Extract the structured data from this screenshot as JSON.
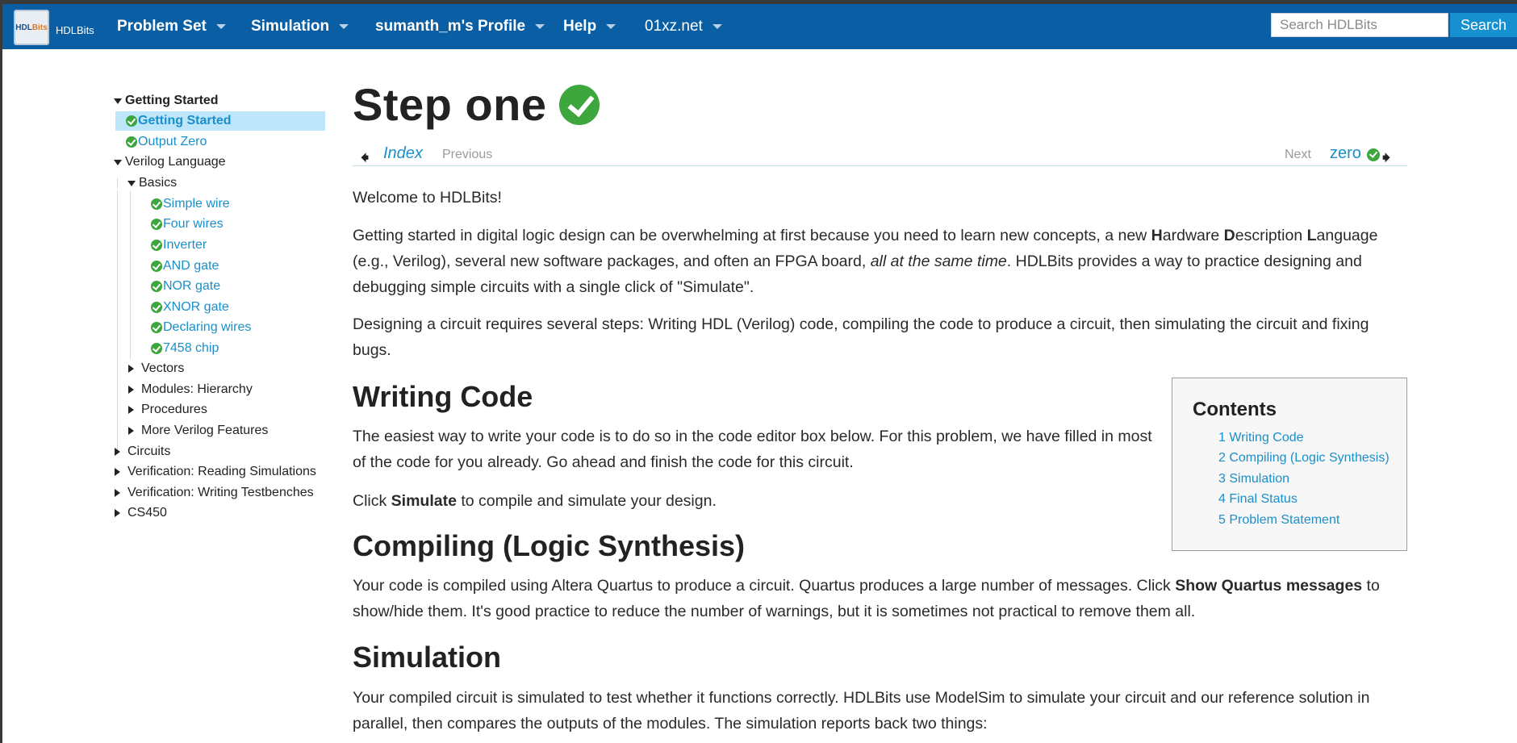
{
  "header": {
    "logo_text_a": "HDL",
    "logo_text_b": "Bits",
    "brand": "HDLBits",
    "menus": [
      {
        "label": "Problem Set"
      },
      {
        "label": "Simulation"
      },
      {
        "label": "sumanth_m's Profile"
      },
      {
        "label": "Help"
      },
      {
        "label": "01xz.net"
      }
    ],
    "search_placeholder": "Search HDLBits",
    "search_button": "Search"
  },
  "sidebar": {
    "items": [
      {
        "label": "Getting Started"
      },
      {
        "label": "Getting Started"
      },
      {
        "label": "Output Zero"
      },
      {
        "label": "Verilog Language"
      },
      {
        "label": "Basics"
      },
      {
        "label": "Simple wire"
      },
      {
        "label": "Four wires"
      },
      {
        "label": "Inverter"
      },
      {
        "label": "AND gate"
      },
      {
        "label": "NOR gate"
      },
      {
        "label": "XNOR gate"
      },
      {
        "label": "Declaring wires"
      },
      {
        "label": "7458 chip"
      },
      {
        "label": "Vectors"
      },
      {
        "label": "Modules: Hierarchy"
      },
      {
        "label": "Procedures"
      },
      {
        "label": "More Verilog Features"
      },
      {
        "label": "Circuits"
      },
      {
        "label": "Verification: Reading Simulations"
      },
      {
        "label": "Verification: Writing Testbenches"
      },
      {
        "label": "CS450"
      }
    ]
  },
  "main": {
    "title": "Step one",
    "nav": {
      "index": "Index",
      "previous": "Previous",
      "next": "Next",
      "next_problem": "zero"
    },
    "welcome": "Welcome to HDLBits!",
    "intro_1": "Getting started in digital logic design can be overwhelming at first because you need to learn new concepts, a new ",
    "hw_H": "H",
    "hw_ardware": "ardware ",
    "hw_D": "D",
    "hw_escription": "escription ",
    "hw_L": "L",
    "hw_anguage": "anguage (e.g., Verilog), several new software packages, and often an FPGA board, ",
    "intro_italic": "all at the same time",
    "intro_2": ". HDLBits provides a way to practice designing and debugging simple circuits with a single click of \"Simulate\".",
    "steps": "Designing a circuit requires several steps: Writing HDL (Verilog) code, compiling the code to produce a circuit, then simulating the circuit and fixing bugs.",
    "h_writing": "Writing Code",
    "writing_p": "The easiest way to write your code is to do so in the code editor box below. For this problem, we have filled in most of the code for you already. Go ahead and finish the code for this circuit.",
    "click_a": "Click ",
    "click_b": "Simulate",
    "click_c": " to compile and simulate your design.",
    "h_compiling": "Compiling (Logic Synthesis)",
    "compiling_a": "Your code is compiled using Altera Quartus to produce a circuit. Quartus produces a large number of messages. Click ",
    "compiling_b": "Show Quartus messages",
    "compiling_c": " to show/hide them. It's good practice to reduce the number of warnings, but it is sometimes not practical to remove them all.",
    "h_simulation": "Simulation",
    "simulation_p": "Your compiled circuit is simulated to test whether it functions correctly. HDLBits use ModelSim to simulate your circuit and our reference solution in parallel, then compares the outputs of the modules. The simulation reports back two things:"
  },
  "toc": {
    "title": "Contents",
    "items": [
      {
        "label": "1 Writing Code"
      },
      {
        "label": "2 Compiling (Logic Synthesis)"
      },
      {
        "label": "3 Simulation"
      },
      {
        "label": "4 Final Status"
      },
      {
        "label": "5 Problem Statement"
      }
    ]
  },
  "colors": {
    "nav_bg": "#0a5fa4",
    "link": "#1a8fc9",
    "check_green": "#3da63d",
    "highlight": "#bde6fb",
    "search_button": "#1790d0"
  }
}
